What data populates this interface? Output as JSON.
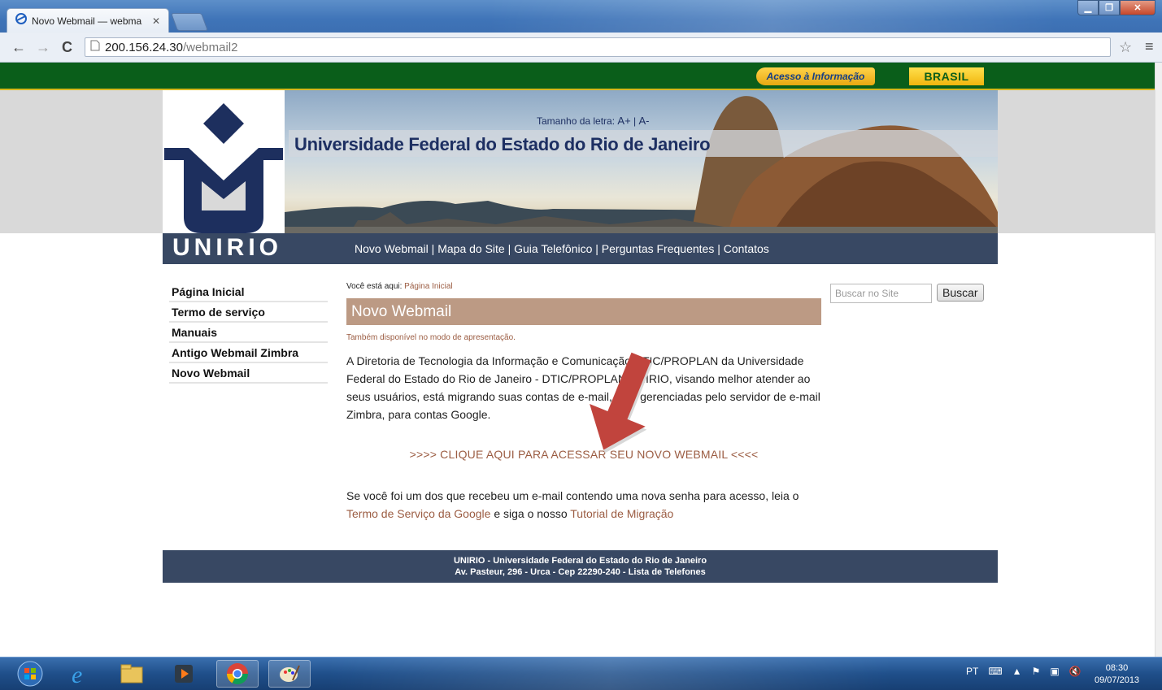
{
  "browser": {
    "tab_title": "Novo Webmail — webma",
    "url_host": "200.156.24.30",
    "url_path": "/webmail2"
  },
  "gov": {
    "acesso": "Acesso à Informação",
    "brasil": "BRASIL"
  },
  "header": {
    "font_size_label": "Tamanho da letra: ",
    "font_increase": "A+",
    "font_sep": " | ",
    "font_decrease": "A-",
    "university_title": "Universidade Federal do Estado do Rio de Janeiro",
    "logo_word": "UNIRIO"
  },
  "topnav": {
    "items": [
      "Novo Webmail",
      "Mapa do Site",
      "Guia Telefônico",
      "Perguntas Frequentes",
      "Contatos"
    ],
    "separator": " | "
  },
  "sidebar": {
    "items": [
      {
        "label": "Página Inicial"
      },
      {
        "label": "Termo de serviço"
      },
      {
        "label": "Manuais"
      },
      {
        "label": "Antigo Webmail Zimbra"
      },
      {
        "label": "Novo Webmail"
      }
    ]
  },
  "search": {
    "placeholder": "Buscar no Site",
    "button": "Buscar"
  },
  "content": {
    "breadcrumb_prefix": "Você está aqui: ",
    "breadcrumb_link": "Página Inicial",
    "title": "Novo Webmail",
    "presentation_note": "Também disponível no modo de apresentação.",
    "paragraph1": "A Diretoria de Tecnologia da Informação e Comunicação DTIC/PROPLAN da Universidade Federal do Estado do Rio de Janeiro - DTIC/PROPLAN/UNIRIO, visando melhor atender ao seus usuários, está migrando suas contas de e-mail, hoje gerenciadas pelo servidor de e-mail Zimbra, para contas Google.",
    "cta": ">>>> CLIQUE AQUI PARA ACESSAR SEU NOVO WEBMAIL <<<<",
    "p2_before": "Se você foi um dos que recebeu um e-mail contendo uma nova senha para acesso, leia o ",
    "p2_link1": "Termo de Serviço da Google",
    "p2_middle": " e siga o nosso ",
    "p2_link2": "Tutorial de Migração"
  },
  "footer": {
    "line1": "UNIRIO - Universidade Federal do Estado do Rio de Janeiro",
    "line2": "Av. Pasteur, 296 - Urca - Cep 22290-240 - Lista de Telefones"
  },
  "taskbar": {
    "language": "PT",
    "time": "08:30",
    "date": "09/07/2013"
  },
  "colors": {
    "gov_green": "#0a5e1a",
    "navy": "#384863",
    "title_bg": "#bc9a84",
    "link_brown": "#9b5c42",
    "arrow_red": "#c1443d"
  }
}
